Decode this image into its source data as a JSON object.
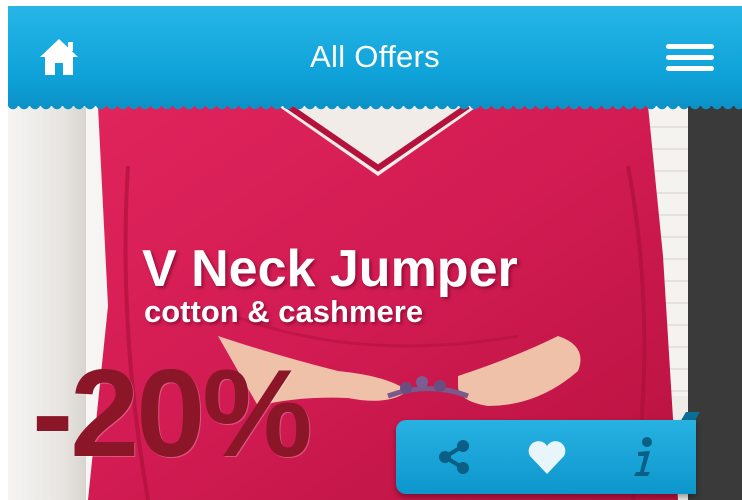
{
  "header": {
    "title": "All Offers",
    "home_icon": "home-icon",
    "menu_icon": "hamburger-menu-icon",
    "color": "#10a3d9"
  },
  "offer": {
    "title": "V Neck Jumper",
    "subtitle": "cotton & cashmere",
    "discount": "-20%",
    "discount_color": "#8a1628",
    "product_color": "#d11b52"
  },
  "actions": {
    "share_icon": "share-icon",
    "like_icon": "heart-icon",
    "info_icon": "info-icon"
  }
}
